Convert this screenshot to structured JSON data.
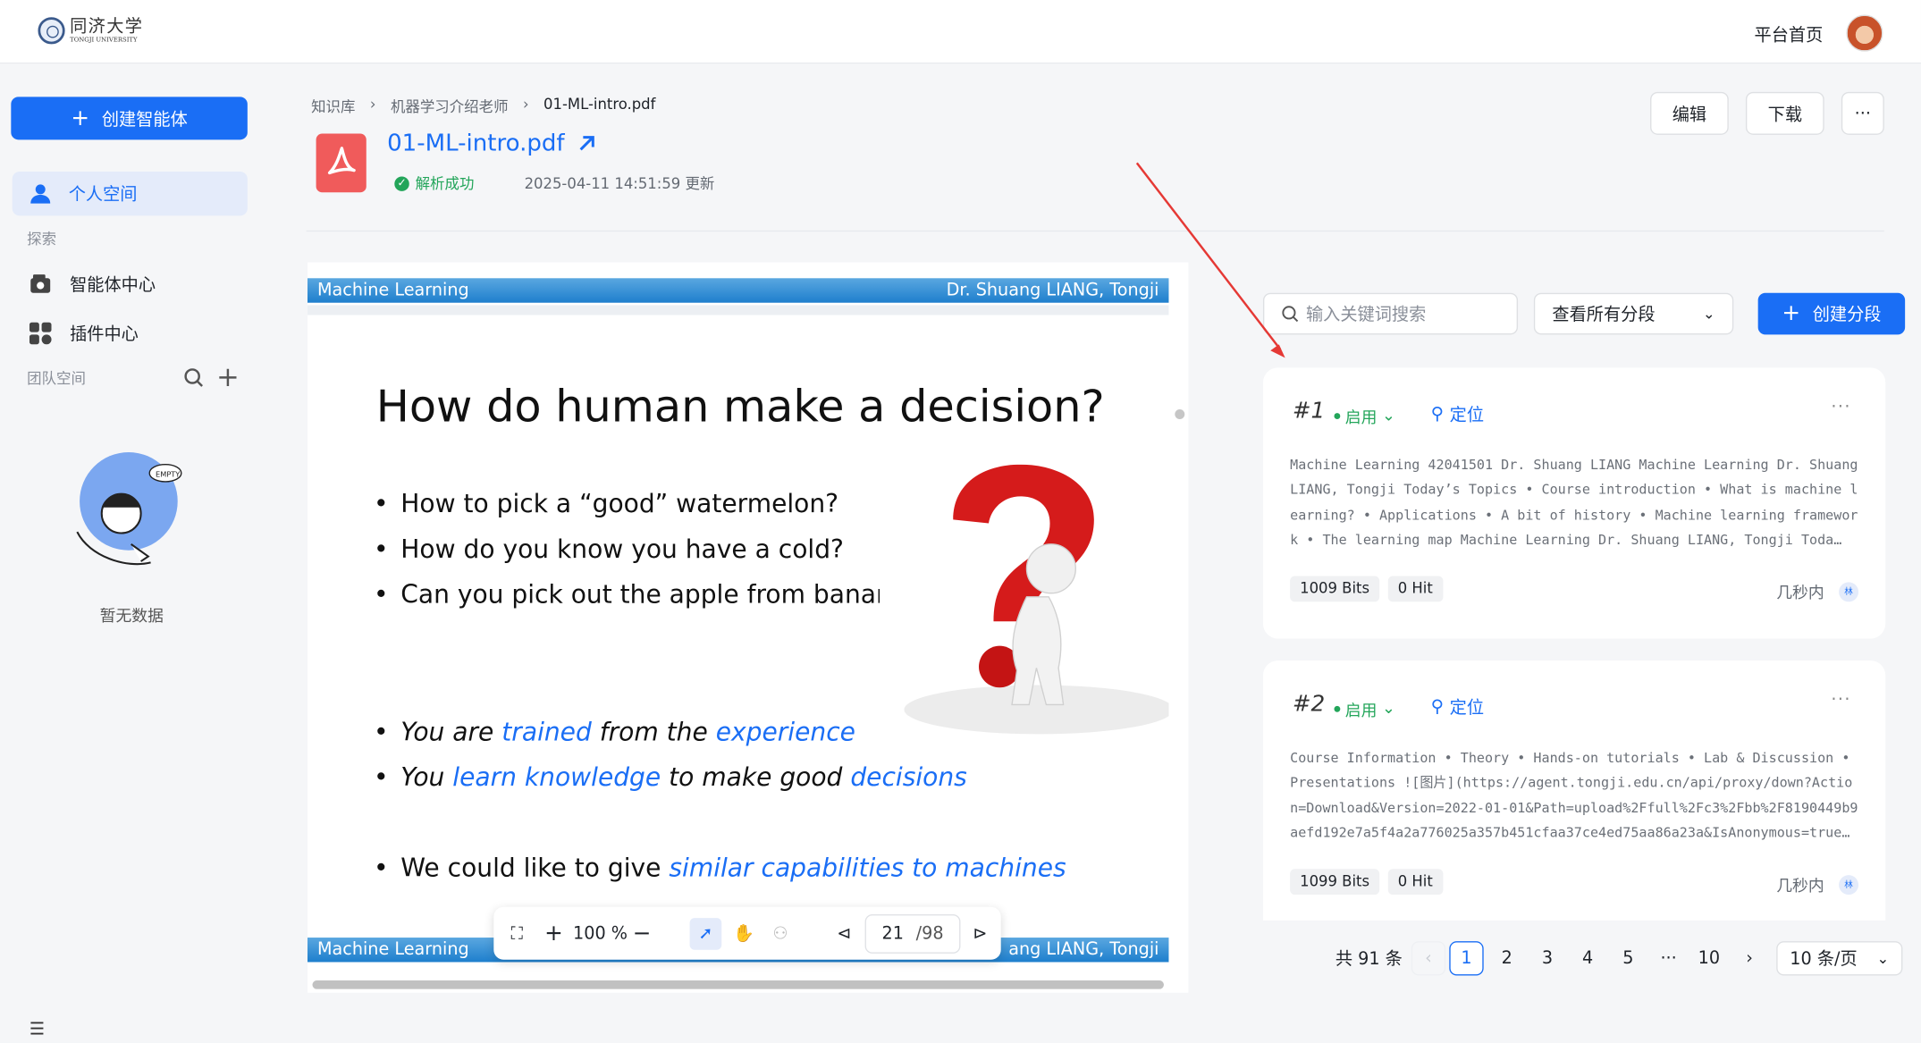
{
  "header": {
    "logo_cn": "同济大学",
    "logo_en": "TONGJI UNIVERSITY",
    "home_link": "平台首页"
  },
  "sidebar": {
    "create_label": "创建智能体",
    "personal_space": "个人空间",
    "explore_label": "探索",
    "items": [
      {
        "label": "智能体中心",
        "icon": "bot-icon"
      },
      {
        "label": "插件中心",
        "icon": "apps-icon"
      }
    ],
    "team_space_label": "团队空间",
    "empty_text": "暂无数据",
    "empty_badge": "EMPTY"
  },
  "breadcrumb": [
    "知识库",
    "机器学习介绍老师",
    "01-ML-intro.pdf"
  ],
  "file": {
    "name": "01-ML-intro.pdf",
    "status": "解析成功",
    "updated": "2025-04-11 14:51:59 更新"
  },
  "actions": {
    "edit": "编辑",
    "download": "下载",
    "more": "···"
  },
  "slide": {
    "header_left": "Machine Learning",
    "header_right": "Dr. Shuang LIANG, Tongji",
    "footer_right": "ang LIANG, Tongji",
    "title": "How do human make a decision?",
    "bullets": [
      "How to pick a “good” watermelon?",
      "How do you know you have a cold?",
      "Can you pick out the apple from bananas?"
    ],
    "b4": {
      "p1": "You are ",
      "p2": "trained",
      "p3": " from the ",
      "p4": "experience"
    },
    "b5": {
      "p1": "You ",
      "p2": "learn knowledge",
      "p3": " to make good ",
      "p4": "decisions"
    },
    "b6": {
      "p1": "We could like to give ",
      "p2": "similar capabilities to machines"
    }
  },
  "viewer": {
    "zoom": "100 %",
    "page": "21",
    "total": "/98"
  },
  "segments": {
    "search_placeholder": "输入关键词搜索",
    "filter": "查看所有分段",
    "create_label": "创建分段",
    "cards": [
      {
        "num": "#1",
        "status": "启用",
        "locate": "定位",
        "text": "Machine Learning 42041501 Dr. Shuang LIANG Machine Learning Dr. Shuang LIANG, Tongji Today’s Topics • Course introduction • What is machine learning? • Applications • A bit of history • Machine learning framework • The learning map Machine Learning Dr. Shuang LIANG, Tongji Toda…",
        "bits": "1009 Bits",
        "hits": "0 Hit",
        "time": "几秒内",
        "user": "林"
      },
      {
        "num": "#2",
        "status": "启用",
        "locate": "定位",
        "text": "Course Information • Theory • Hands-on tutorials • Lab & Discussion • Presentations ![图片](https://agent.tongji.edu.cn/api/proxy/down?Action=Download&Version=2022-01-01&Path=upload%2Ffull%2Fc3%2Fbb%2F8190449b9aefd192e7a5f4a2a776025a357b451cfaa37ce4ed75aa86a23a&IsAnonymous=true…",
        "bits": "1099 Bits",
        "hits": "0 Hit",
        "time": "几秒内",
        "user": "林"
      }
    ]
  },
  "pagination": {
    "total": "共 91 条",
    "pages": [
      "1",
      "2",
      "3",
      "4",
      "5",
      "···",
      "10"
    ],
    "current": "1",
    "page_size": "10 条/页"
  },
  "colors": {
    "primary": "#1a6ef5",
    "success": "#23a55a",
    "annotation": "#e53935"
  }
}
